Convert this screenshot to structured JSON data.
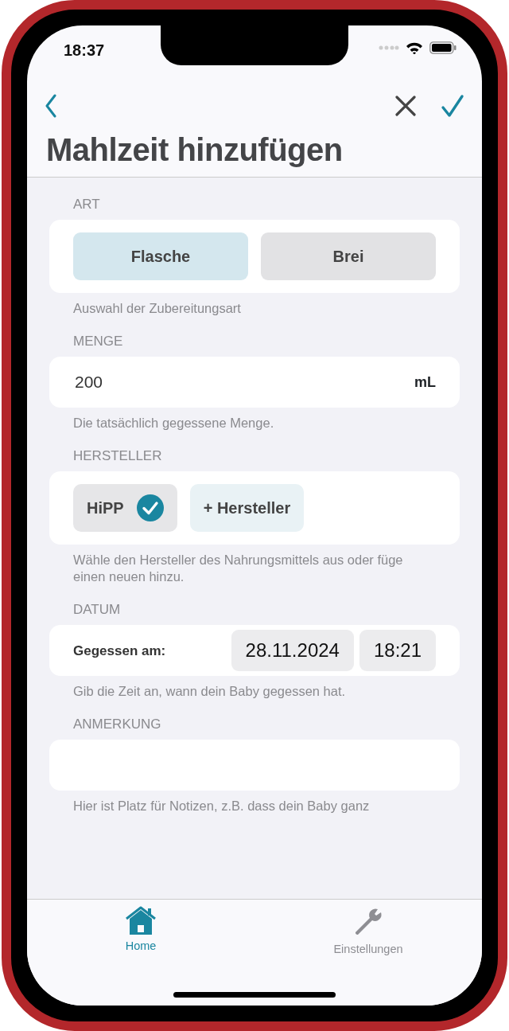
{
  "status_bar": {
    "time": "18:37"
  },
  "nav": {
    "title": "Mahlzeit hinzufügen"
  },
  "sections": [
    {
      "kind": "segmented",
      "header": "ART",
      "options": [
        {
          "label": "Flasche",
          "selected": true
        },
        {
          "label": "Brei",
          "selected": false
        }
      ],
      "footer": "Auswahl der Zubereitungsart"
    },
    {
      "kind": "amount",
      "header": "MENGE",
      "value": "200",
      "unit": "mL",
      "footer": "Die tatsächlich gegessene Menge."
    },
    {
      "kind": "chips",
      "header": "HERSTELLER",
      "chips": [
        {
          "label": "HiPP",
          "selected": true
        }
      ],
      "add_button": "+ Hersteller",
      "footer": "Wähle den Hersteller des Nahrungsmittels aus oder füge einen neuen hinzu."
    },
    {
      "kind": "date",
      "header": "DATUM",
      "label": "Gegessen am:",
      "date": "28.11.2024",
      "time": "18:21",
      "footer": "Gib die Zeit an, wann dein Baby gegessen hat."
    },
    {
      "kind": "note",
      "header": "ANMERKUNG",
      "footer": "Hier ist Platz für Notizen, z.B. dass dein Baby ganz"
    }
  ],
  "tab_bar": [
    {
      "label": "Home",
      "selected": true
    },
    {
      "label": "Einstellungen",
      "selected": false
    }
  ]
}
